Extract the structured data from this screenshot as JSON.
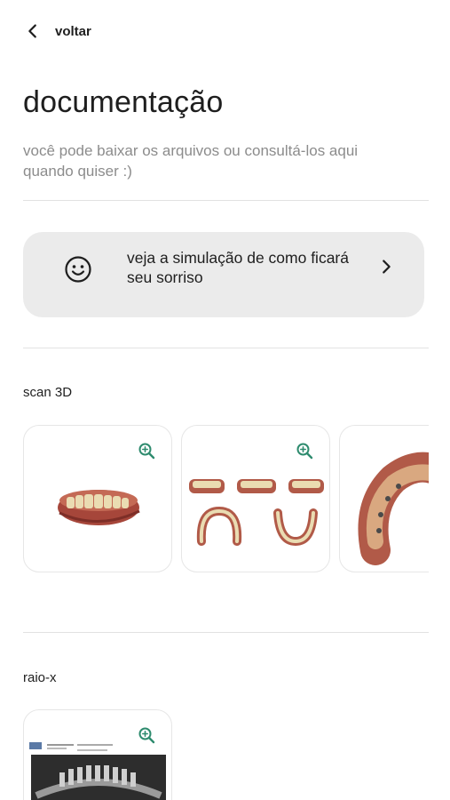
{
  "header": {
    "back_label": "voltar",
    "back_icon": "chevron-left-icon"
  },
  "page": {
    "title": "documentação",
    "subtitle": "você pode baixar os arquivos ou consultá-los aqui quando quiser :)"
  },
  "simulation_card": {
    "icon": "smile-icon",
    "text": "veja a simulação de como ficará seu sorriso",
    "arrow_icon": "chevron-right-icon"
  },
  "sections": {
    "scan": {
      "label": "scan 3D",
      "zoom_icon": "zoom-in-icon",
      "item_count_visible": 3
    },
    "xray": {
      "label": "raio-x",
      "zoom_icon": "zoom-in-icon"
    }
  },
  "colors": {
    "accent": "#2e8b6e",
    "card_bg": "#ebebeb",
    "muted_text": "#8c8c8c",
    "divider": "#e2e2e2"
  }
}
